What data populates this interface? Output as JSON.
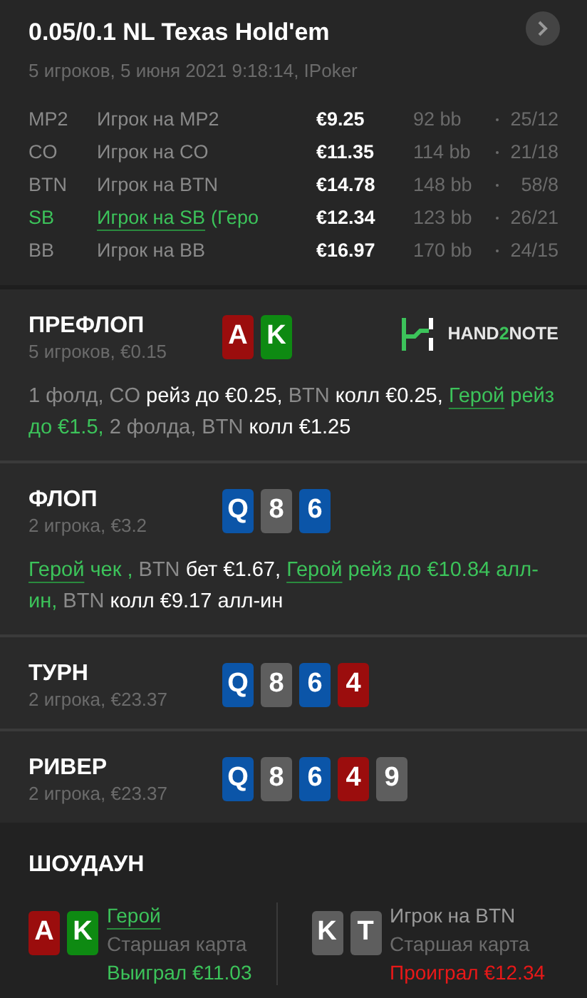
{
  "header": {
    "title": "0.05/0.1 NL Texas Hold'em",
    "subtitle": "5 игроков, 5 июня 2021 9:18:14, IPoker"
  },
  "players": [
    {
      "position": "MP2",
      "name": "Игрок на MP2",
      "hero": false,
      "stack": "€9.25",
      "bb": "92 bb",
      "stats": "25/12"
    },
    {
      "position": "CO",
      "name": "Игрок на CO",
      "hero": false,
      "stack": "€11.35",
      "bb": "114 bb",
      "stats": "21/18"
    },
    {
      "position": "BTN",
      "name": "Игрок на BTN",
      "hero": false,
      "stack": "€14.78",
      "bb": "148 bb",
      "stats": "58/8"
    },
    {
      "position": "SB",
      "name": "Игрок на SB",
      "suffix": "(Геро",
      "hero": true,
      "stack": "€12.34",
      "bb": "123 bb",
      "stats": "26/21"
    },
    {
      "position": "BB",
      "name": "Игрок на BB",
      "hero": false,
      "stack": "€16.97",
      "bb": "170 bb",
      "stats": "24/15"
    }
  ],
  "streets": [
    {
      "title": "ПРЕФЛОП",
      "info": "5 игроков, €0.15",
      "cards": [
        {
          "rank": "A",
          "color": "#9b0d0d"
        },
        {
          "rank": "K",
          "color": "#0e8a12"
        }
      ],
      "logo": [
        {
          "text": "HAND",
          "accent": false
        },
        {
          "text": "2",
          "accent": true
        },
        {
          "text": "NOTE",
          "accent": false
        }
      ],
      "actions": [
        {
          "kind": "info",
          "text": "1 фолд,"
        },
        {
          "kind": "pos",
          "text": "CO"
        },
        {
          "kind": "act",
          "text": "рейз до €0.25,"
        },
        {
          "kind": "pos",
          "text": "BTN"
        },
        {
          "kind": "act",
          "text": "колл €0.25,"
        },
        {
          "kind": "hero",
          "text": "Герой"
        },
        {
          "kind": "hero_act",
          "text": "рейз до €1.5,"
        },
        {
          "kind": "info",
          "text": "2 фолда,"
        },
        {
          "kind": "pos",
          "text": "BTN"
        },
        {
          "kind": "act",
          "text": "колл €1.25"
        }
      ]
    },
    {
      "title": "ФЛОП",
      "info": "2 игрока, €3.2",
      "cards": [
        {
          "rank": "Q",
          "color": "#0b55a8"
        },
        {
          "rank": "8",
          "color": "#5e5e5e"
        },
        {
          "rank": "6",
          "color": "#0b55a8"
        }
      ],
      "actions": [
        {
          "kind": "hero",
          "text": "Герой"
        },
        {
          "kind": "hero_act",
          "text": "чек ,"
        },
        {
          "kind": "pos",
          "text": "BTN"
        },
        {
          "kind": "act",
          "text": "бет €1.67,"
        },
        {
          "kind": "hero",
          "text": "Герой"
        },
        {
          "kind": "hero_act",
          "text": "рейз до €10.84 алл-ин,"
        },
        {
          "kind": "pos",
          "text": "BTN"
        },
        {
          "kind": "act",
          "text": "колл €9.17 алл-ин"
        }
      ]
    },
    {
      "title": "ТУРН",
      "info": "2 игрока, €23.37",
      "cards": [
        {
          "rank": "Q",
          "color": "#0b55a8"
        },
        {
          "rank": "8",
          "color": "#5e5e5e"
        },
        {
          "rank": "6",
          "color": "#0b55a8"
        },
        {
          "rank": "4",
          "color": "#9b0d0d"
        }
      ]
    },
    {
      "title": "РИВЕР",
      "info": "2 игрока, €23.37",
      "cards": [
        {
          "rank": "Q",
          "color": "#0b55a8"
        },
        {
          "rank": "8",
          "color": "#5e5e5e"
        },
        {
          "rank": "6",
          "color": "#0b55a8"
        },
        {
          "rank": "4",
          "color": "#9b0d0d"
        },
        {
          "rank": "9",
          "color": "#5e5e5e"
        }
      ]
    }
  ],
  "showdown": {
    "title": "ШОУДАУН",
    "hands": [
      {
        "name": "Герой",
        "hero": true,
        "cards": [
          {
            "rank": "A",
            "color": "#9b0d0d"
          },
          {
            "rank": "K",
            "color": "#0e8a12"
          }
        ],
        "combo": "Старшая карта",
        "result": "Выиграл €11.03",
        "won": true
      },
      {
        "name": "Игрок на BTN",
        "hero": false,
        "cards": [
          {
            "rank": "K",
            "color": "#5e5e5e"
          },
          {
            "rank": "T",
            "color": "#5e5e5e"
          }
        ],
        "combo": "Старшая карта",
        "result": "Проиграл €12.34",
        "won": false
      }
    ]
  }
}
